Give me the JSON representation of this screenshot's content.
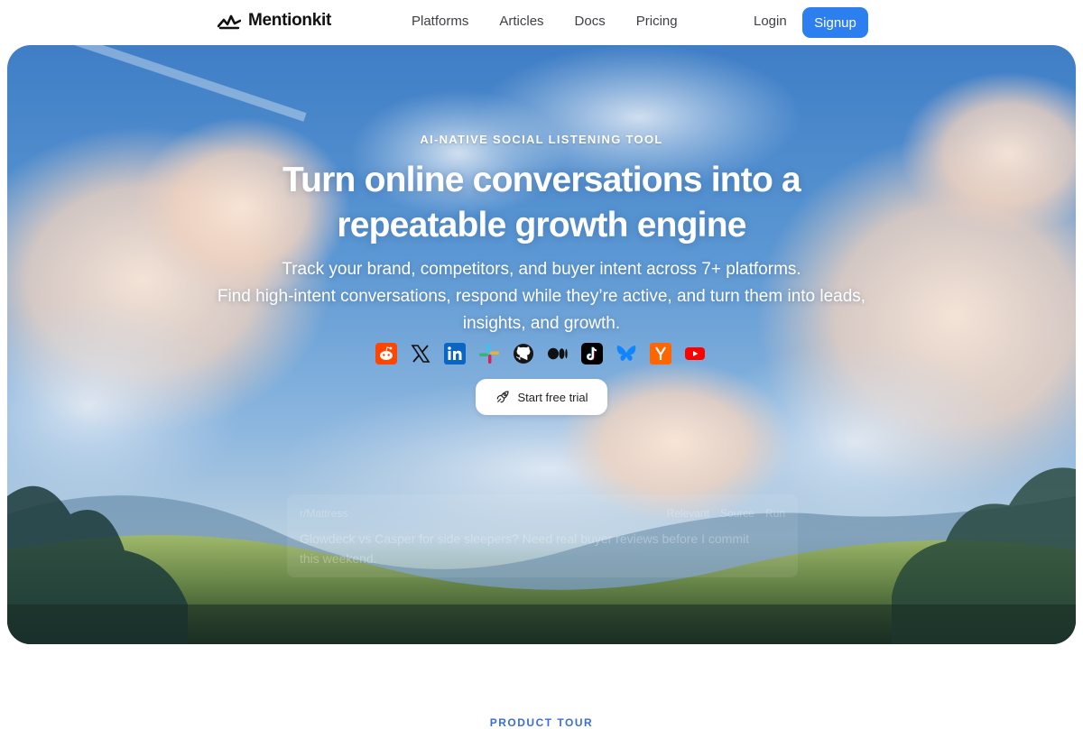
{
  "brand": {
    "name": "Mentionkit"
  },
  "nav": {
    "links": [
      "Platforms",
      "Articles",
      "Docs",
      "Pricing"
    ],
    "login": "Login",
    "signup": "Signup"
  },
  "hero": {
    "eyebrow": "AI-NATIVE SOCIAL LISTENING TOOL",
    "headline": "Turn online conversations into a repeatable growth engine",
    "subtext_line1": "Track your brand, competitors, and buyer intent across 7+ platforms.",
    "subtext_line2": "Find high-intent conversations, respond while they’re active, and turn them into leads, insights, and growth.",
    "platform_icons": [
      "reddit-icon",
      "x-icon",
      "linkedin-icon",
      "slack-icon",
      "github-icon",
      "medium-icon",
      "tiktok-icon",
      "bluesky-icon",
      "hacker-news-icon",
      "youtube-icon"
    ],
    "cta": "Start free trial"
  },
  "preview": {
    "subreddit": "r/Mattress",
    "filter": "Relevant",
    "source": "Source",
    "run": "Run",
    "post_title": "Glowdeck vs Casper for side sleepers? Need real buyer reviews before I commit this weekend."
  },
  "next_section": {
    "label": "PRODUCT TOUR"
  },
  "colors": {
    "accent": "#2d7ff0",
    "section_label": "#3b6fd8"
  }
}
